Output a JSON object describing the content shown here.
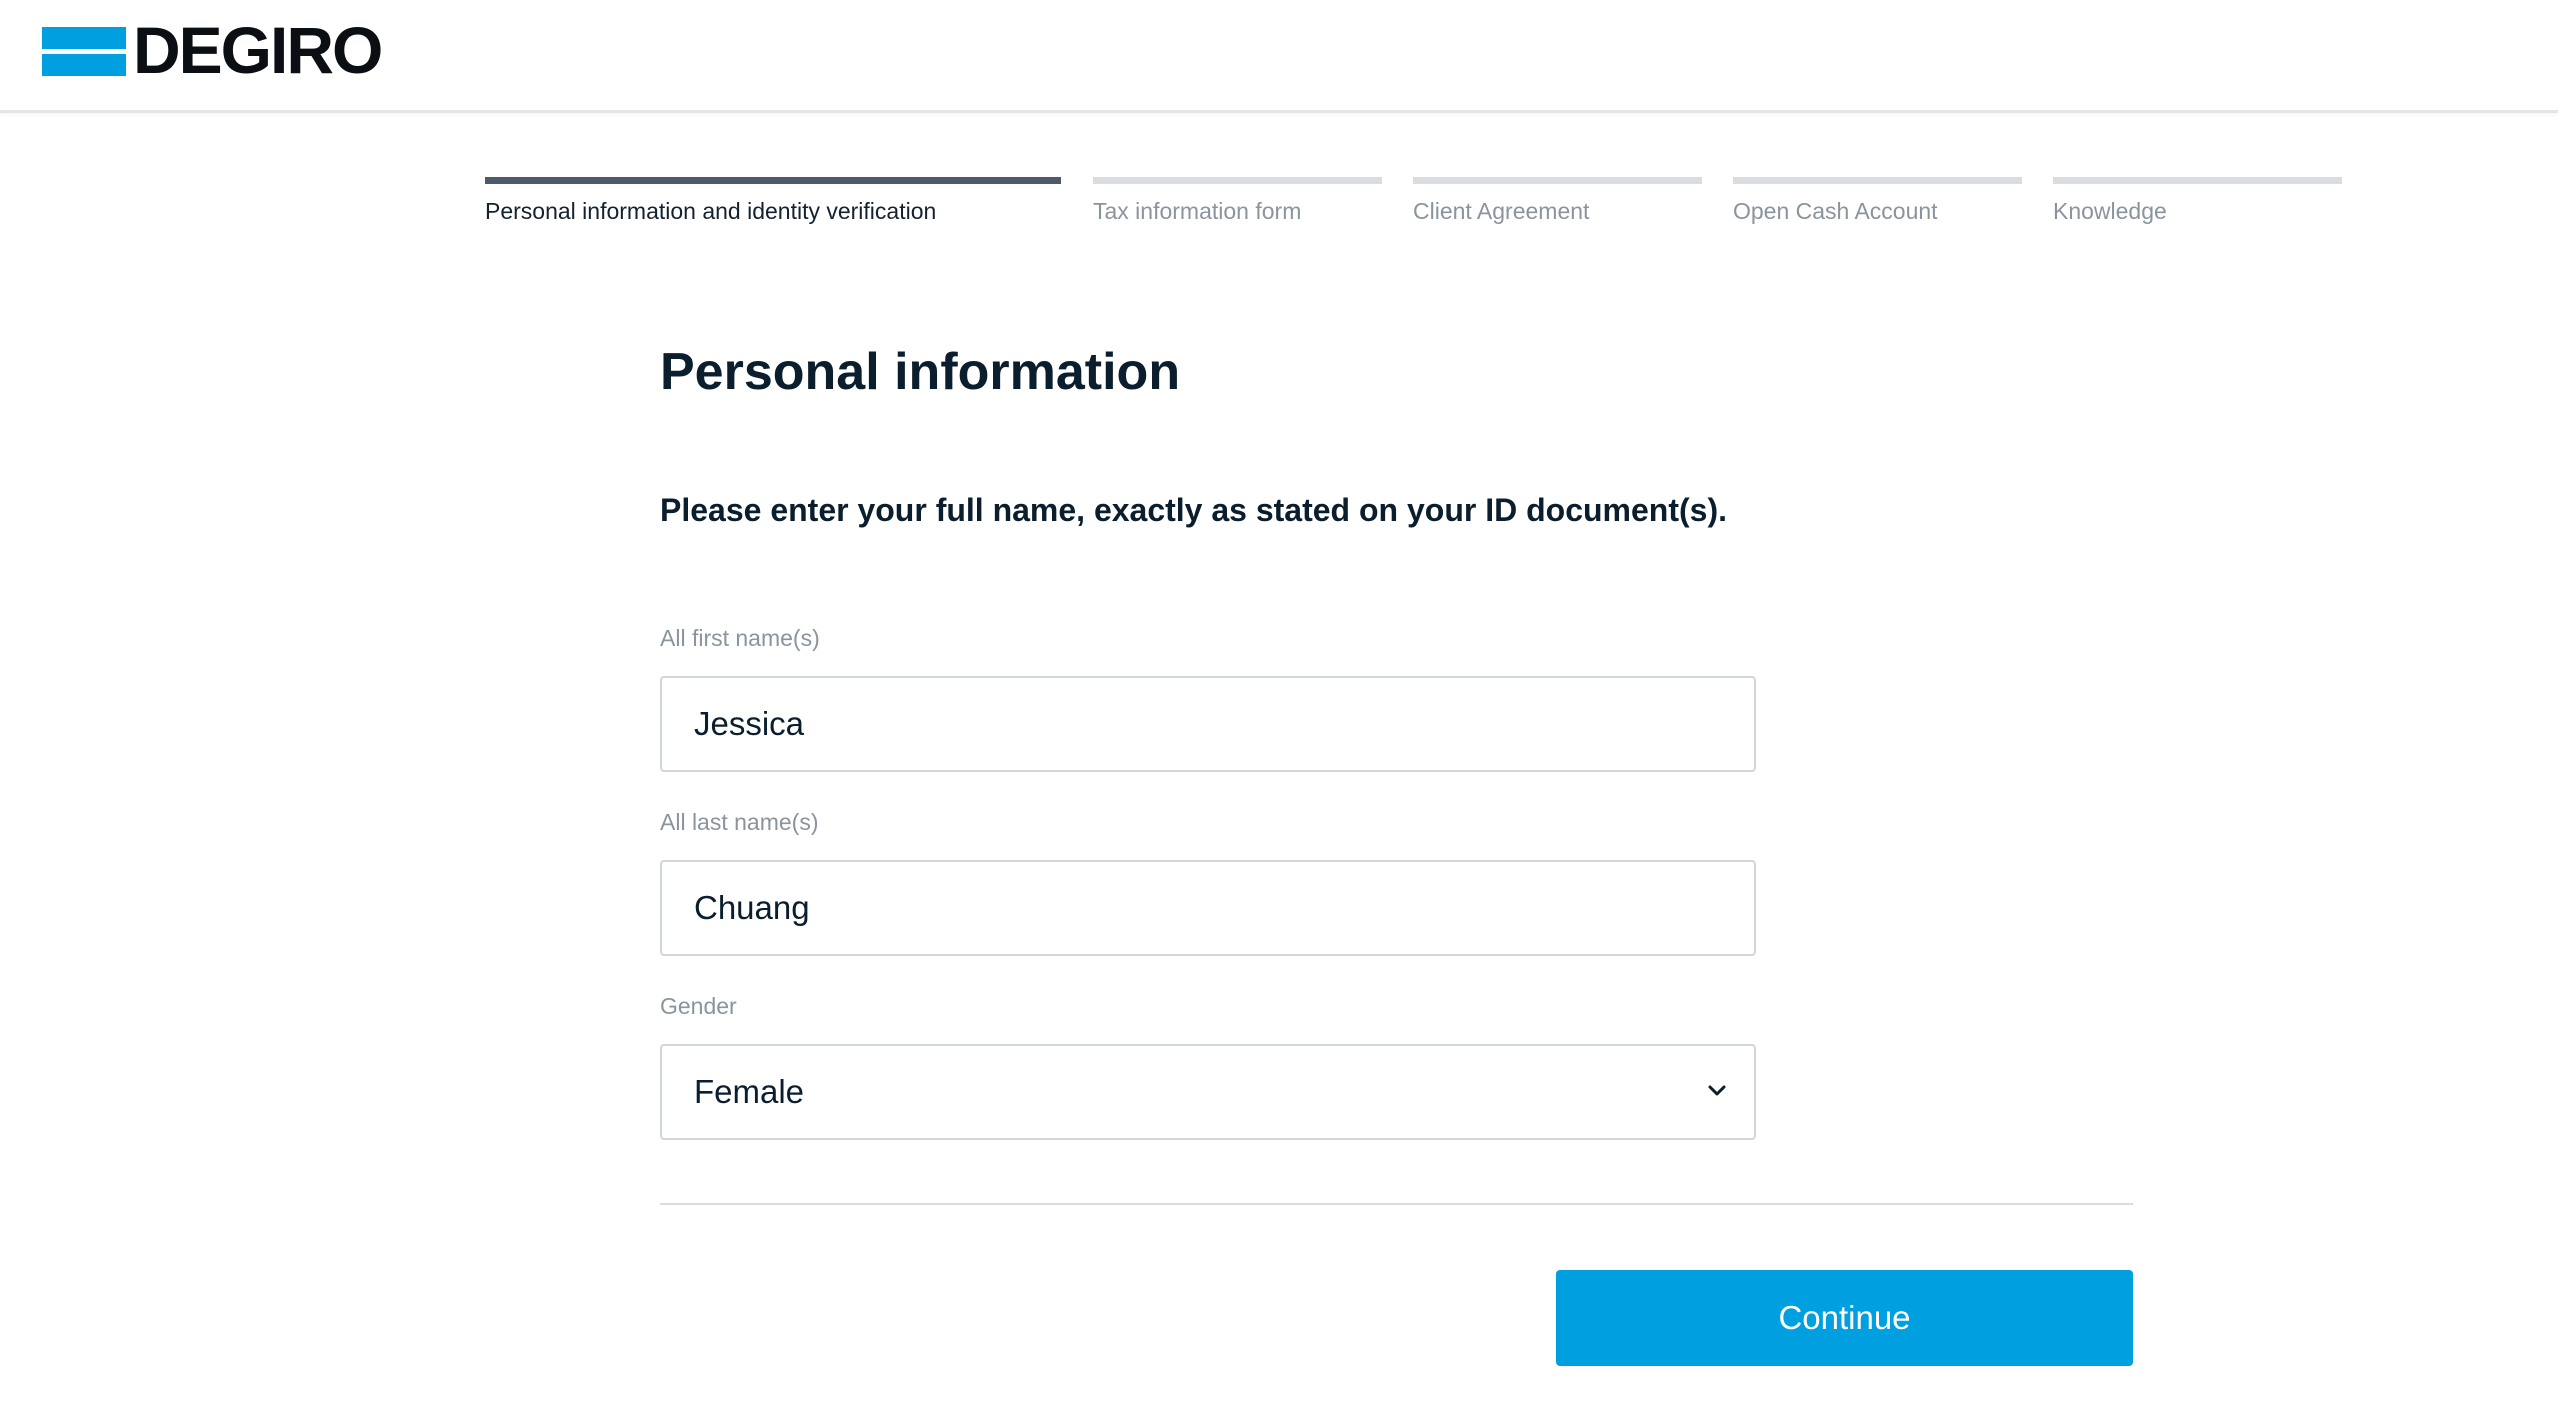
{
  "brand": {
    "name": "DEGIRO",
    "accent_color": "#009fdf"
  },
  "stepper": {
    "active_index": 0,
    "steps": [
      {
        "label": "Personal information and identity verification",
        "state": "active"
      },
      {
        "label": "Tax information form",
        "state": "upcoming"
      },
      {
        "label": "Client Agreement",
        "state": "upcoming"
      },
      {
        "label": "Open Cash Account",
        "state": "upcoming"
      },
      {
        "label": "Knowledge",
        "state": "upcoming"
      }
    ]
  },
  "form": {
    "title": "Personal information",
    "instruction": "Please enter your full name, exactly as stated on your ID document(s).",
    "first_name": {
      "label": "All first name(s)",
      "value": "Jessica"
    },
    "last_name": {
      "label": "All last name(s)",
      "value": "Chuang"
    },
    "gender": {
      "label": "Gender",
      "value": "Female",
      "icon": "chevron-down-icon"
    },
    "continue_label": "Continue"
  }
}
